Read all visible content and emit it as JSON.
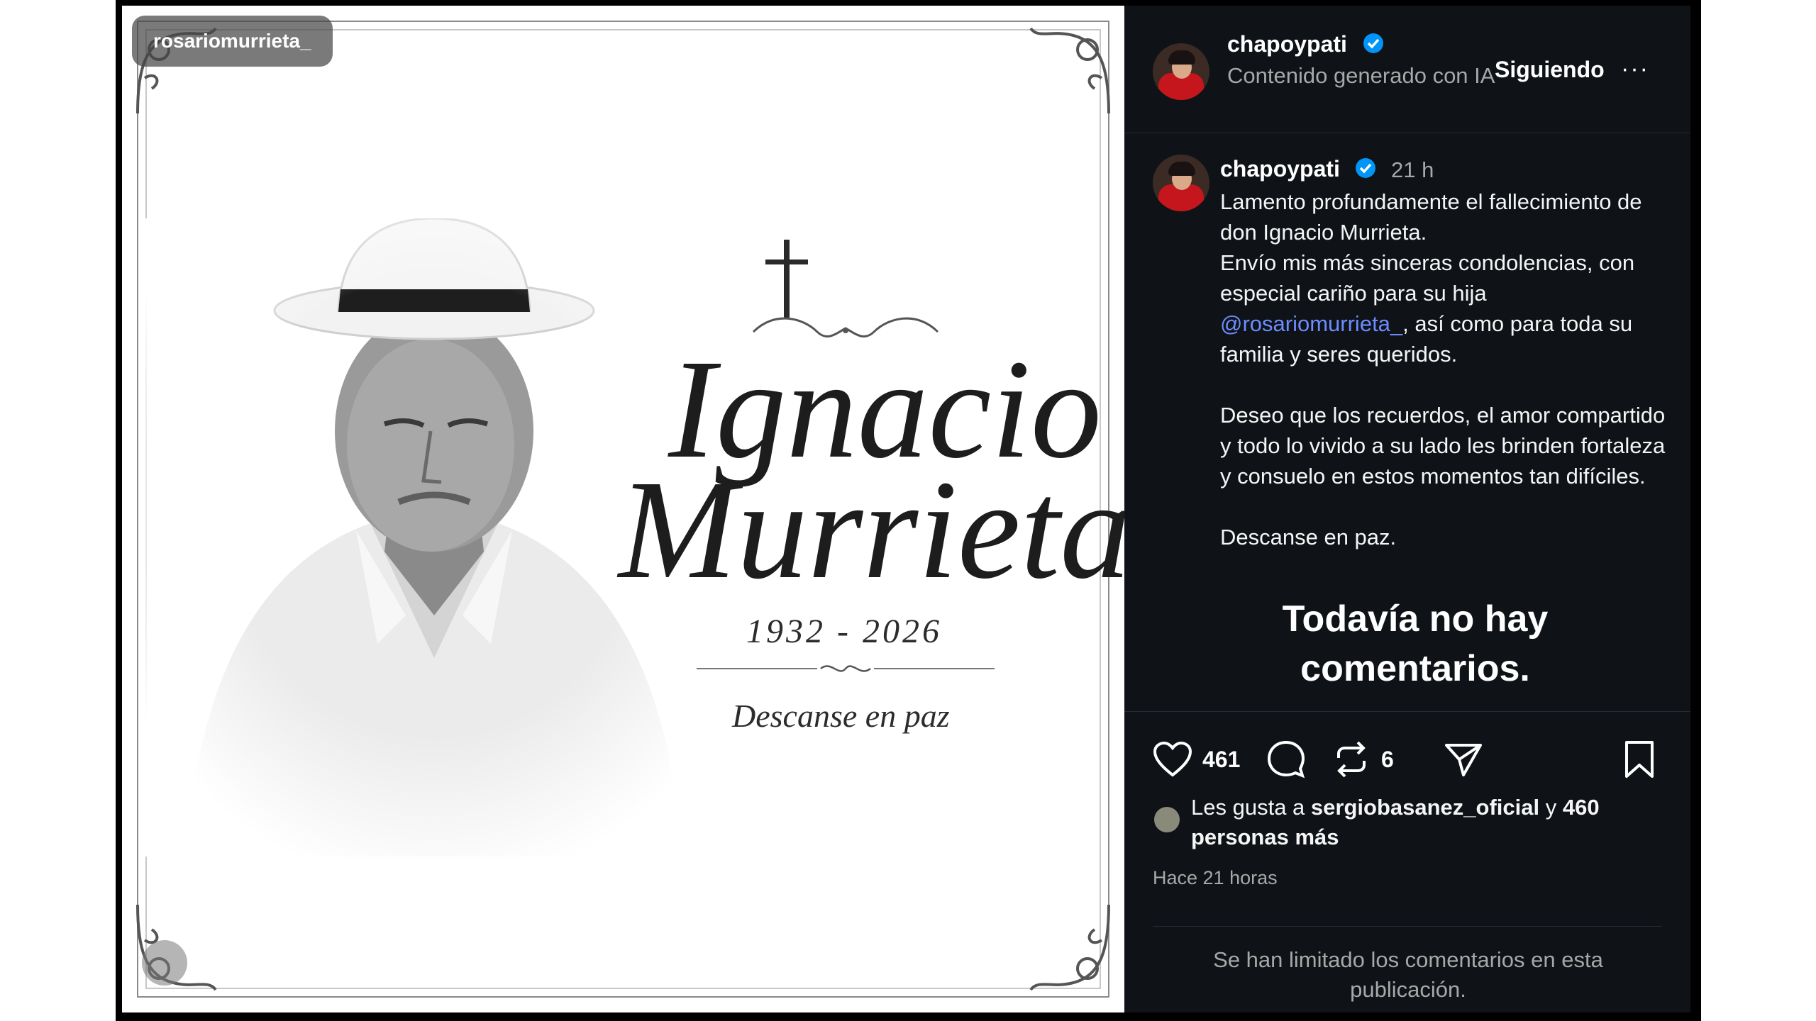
{
  "image": {
    "tag": "rosariomurrieta_",
    "first_name": "Ignacio",
    "last_name": "Murrieta",
    "dates": "1932 - 2026",
    "farewell": "Descanse en paz"
  },
  "header": {
    "username": "chapoypati",
    "ai_label": "Contenido generado con IA",
    "follow_label": "Siguiendo",
    "more_label": "···"
  },
  "post": {
    "username": "chapoypati",
    "time_ago": "21 h",
    "caption_part1": "Lamento profundamente el fallecimiento de don Ignacio Murrieta.\nEnvío mis más sinceras condolencias, con especial cariño para su hija ",
    "caption_mention": "@rosariomurrieta_",
    "caption_part2": ", así como para toda su familia y seres queridos.\n\nDeseo que los recuerdos, el amor compartido y todo lo vivido a su lado les brinden fortaleza y consuelo en estos momentos tan difíciles.\n\nDescanse en paz."
  },
  "comments": {
    "empty_title": "Todavía no hay\ncomentarios."
  },
  "actions": {
    "like_count": "461",
    "repost_count": "6"
  },
  "likes": {
    "prefix": "Les gusta a",
    "user": "sergiobasanez_oficial",
    "connector": "y",
    "others": "460 personas más"
  },
  "timestamp": "Hace 21 horas",
  "comments_limited": "Se han limitado los comentarios en esta publicación.",
  "colors": {
    "panel_bg": "#0f1318",
    "verified_blue": "#0095f6",
    "mention_blue": "#6c8cff",
    "muted_text": "#a8a8a8"
  }
}
